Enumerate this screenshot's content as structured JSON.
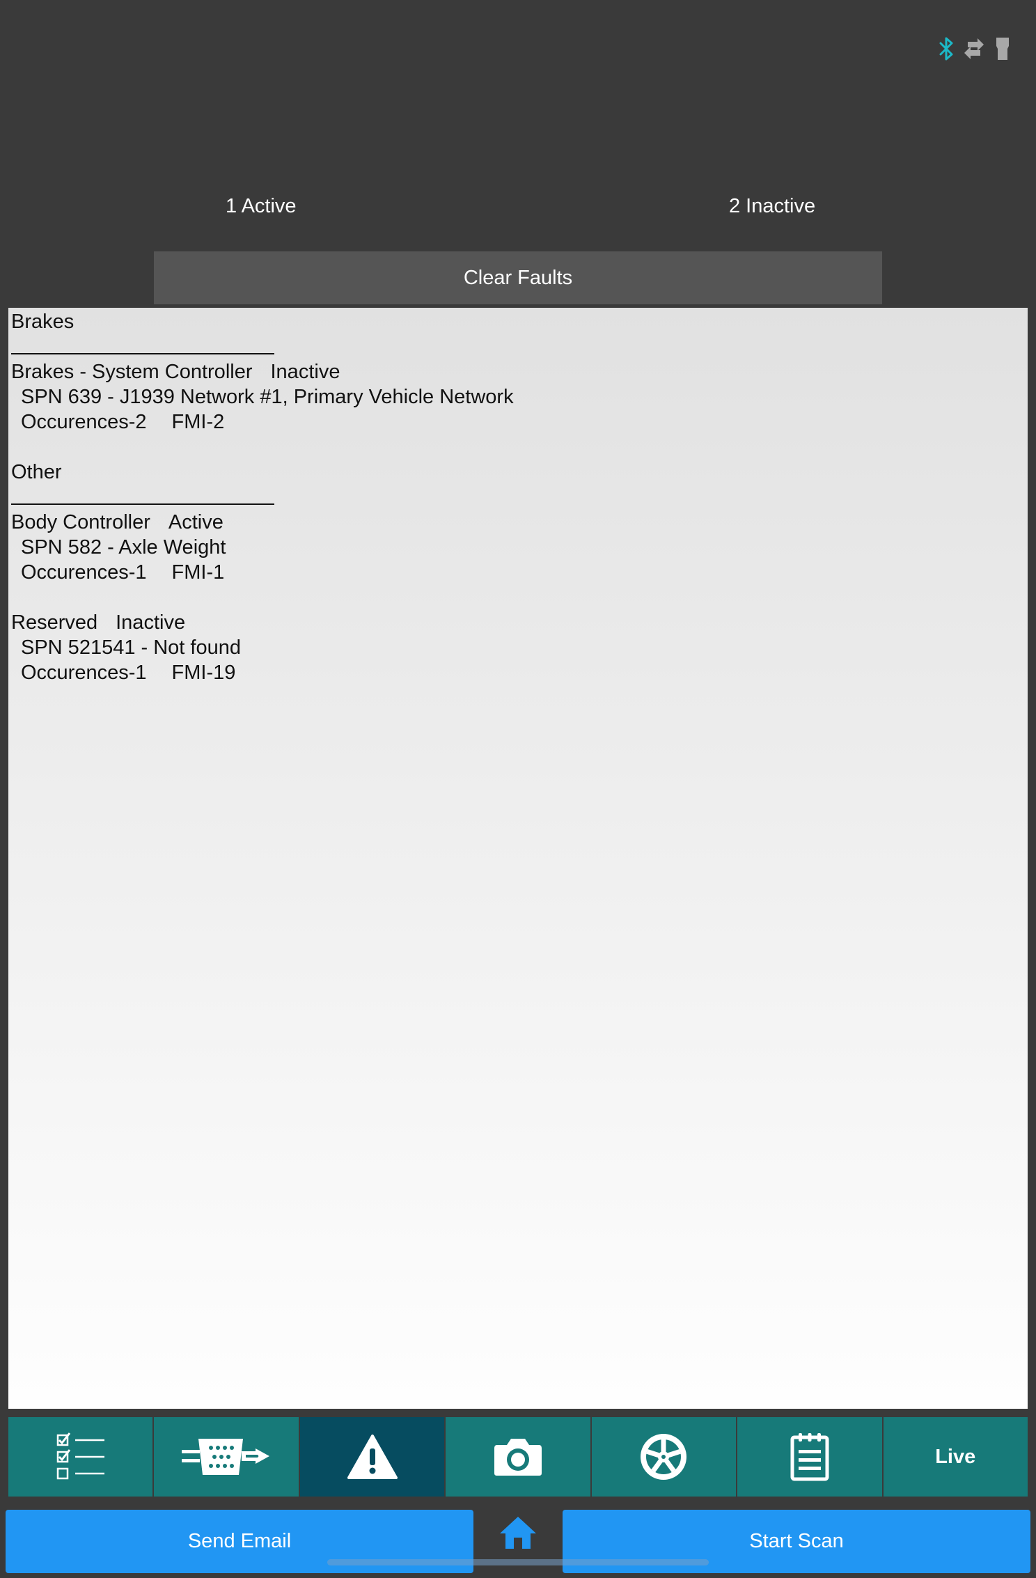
{
  "status_icons": [
    "bluetooth-icon",
    "transfer-arrows-icon",
    "device-icon"
  ],
  "colors": {
    "background": "#3a3a3a",
    "toolbar": "#177a79",
    "toolbar_active": "#064c60",
    "action_blue": "#2196f3",
    "bluetooth": "#1cb9c8"
  },
  "summary": {
    "active": "1 Active",
    "inactive": "2 Inactive"
  },
  "clear_faults_label": "Clear Faults",
  "faults": {
    "brakes_heading": "Brakes",
    "brakes_fault_1": {
      "module": "Brakes - System Controller",
      "status": "Inactive",
      "spn": "SPN 639 - J1939 Network #1, Primary Vehicle Network",
      "occurrences": "Occurences-2",
      "fmi": "FMI-2"
    },
    "other_heading": "Other",
    "other_fault_1": {
      "module": "Body Controller",
      "status": "Active",
      "spn": "SPN 582 - Axle Weight",
      "occurrences": "Occurences-1",
      "fmi": "FMI-1"
    },
    "other_fault_2": {
      "module": "Reserved",
      "status": "Inactive",
      "spn": "SPN 521541 - Not found",
      "occurrences": "Occurences-1",
      "fmi": "FMI-19"
    }
  },
  "toolbar": {
    "items": [
      {
        "icon": "checklist-icon"
      },
      {
        "icon": "connector-icon"
      },
      {
        "icon": "warning-icon",
        "active": true
      },
      {
        "icon": "camera-icon"
      },
      {
        "icon": "wheel-icon"
      },
      {
        "icon": "notepad-icon"
      },
      {
        "label": "Live"
      }
    ]
  },
  "actions": {
    "send_email": "Send Email",
    "home_icon": "home-icon",
    "start_scan": "Start Scan"
  }
}
